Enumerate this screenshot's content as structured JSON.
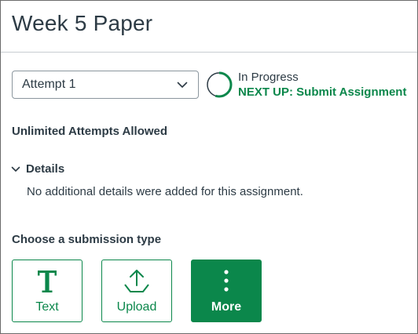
{
  "page": {
    "title": "Week 5 Paper"
  },
  "attempt": {
    "selected": "Attempt 1",
    "status": "In Progress",
    "next_up": "NEXT UP: Submit Assignment",
    "progress": 0.55
  },
  "attempts_allowed": "Unlimited Attempts Allowed",
  "details": {
    "toggle_label": "Details",
    "body": "No additional details were added for this assignment."
  },
  "submission": {
    "heading": "Choose a submission type",
    "options": [
      {
        "label": "Text",
        "icon": "text-T-icon"
      },
      {
        "label": "Upload",
        "icon": "upload-icon"
      },
      {
        "label": "More",
        "icon": "more-vertical-icon"
      }
    ]
  },
  "colors": {
    "accent": "#0b874b",
    "text": "#2d3b45",
    "ring_track": "#2d3b45"
  }
}
